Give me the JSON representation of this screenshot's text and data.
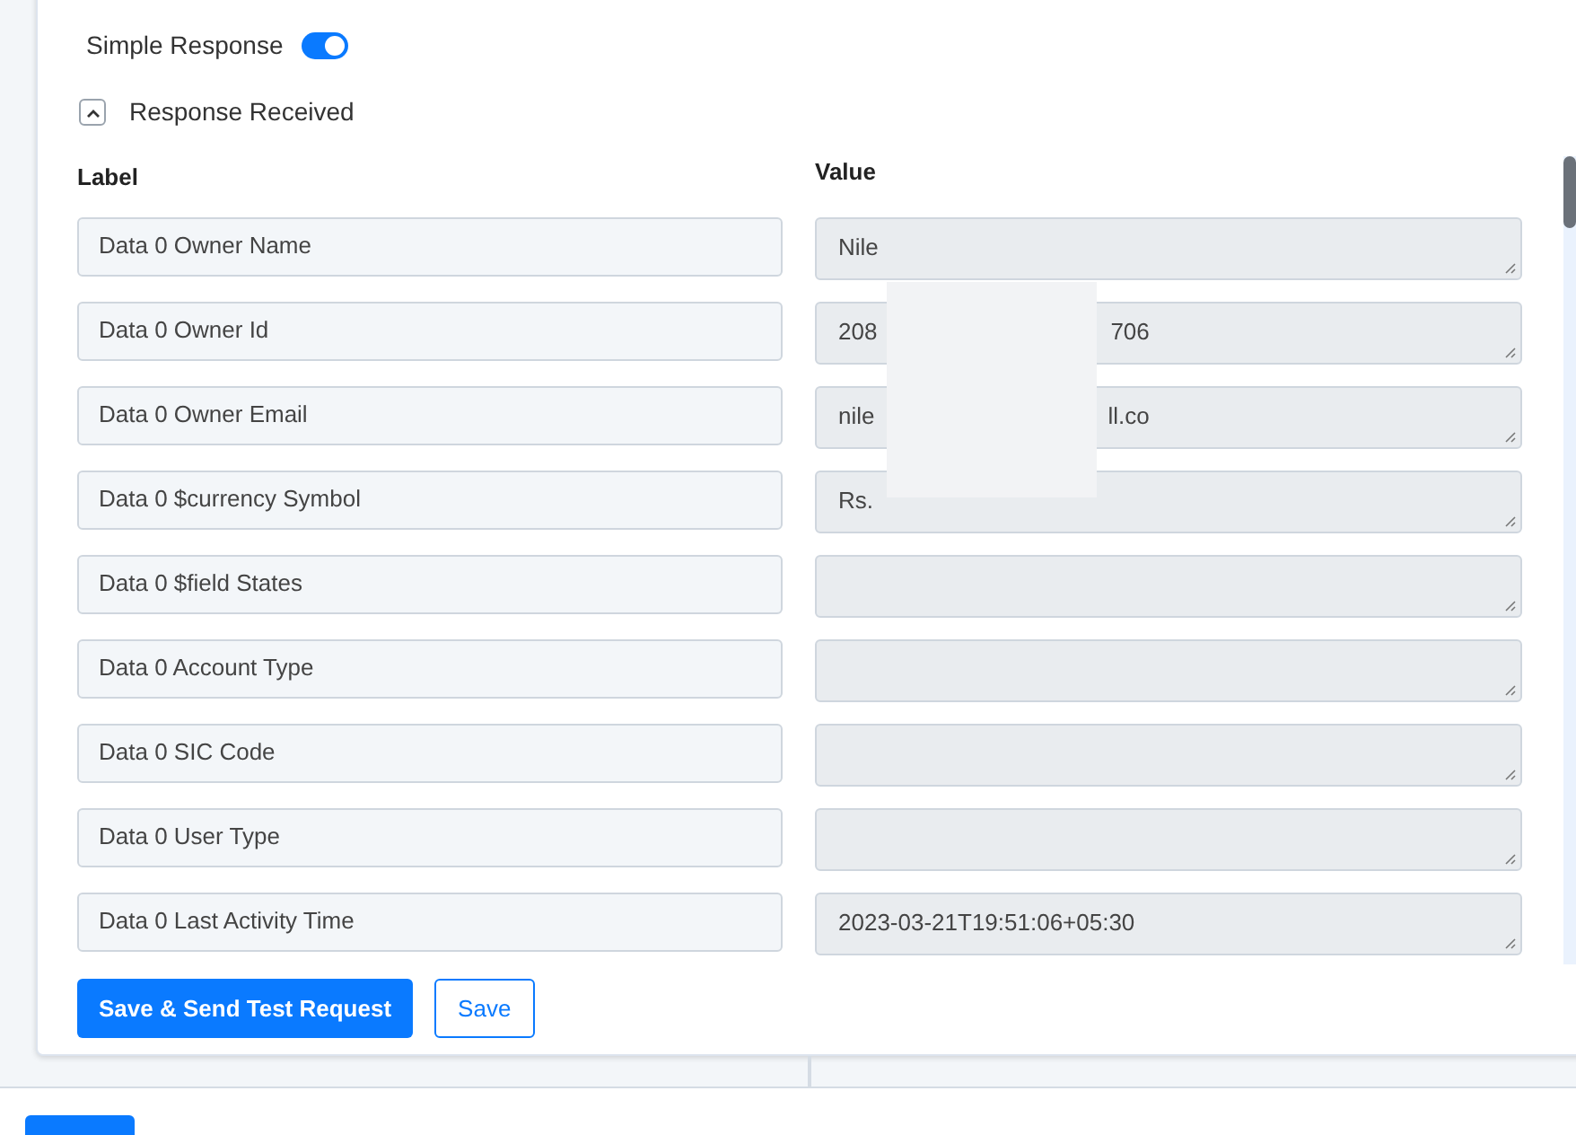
{
  "simple_response": {
    "label": "Simple Response",
    "on": true
  },
  "section": {
    "title": "Response Received",
    "expanded": true
  },
  "columns": {
    "label": "Label",
    "value": "Value"
  },
  "redaction_overlay": true,
  "rows": [
    {
      "label": "Data 0 Owner Name",
      "value_start": "Nile",
      "value_end": ""
    },
    {
      "label": "Data 0 Owner Id",
      "value_start": "208",
      "value_end": "706"
    },
    {
      "label": "Data 0 Owner Email",
      "value_start": "nile",
      "value_end": "ll.co"
    },
    {
      "label": "Data 0 $currency Symbol",
      "value_start": "Rs.",
      "value_end": ""
    },
    {
      "label": "Data 0 $field States",
      "value_start": "",
      "value_end": ""
    },
    {
      "label": "Data 0 Account Type",
      "value_start": "",
      "value_end": ""
    },
    {
      "label": "Data 0 SIC Code",
      "value_start": "",
      "value_end": ""
    },
    {
      "label": "Data 0 User Type",
      "value_start": "",
      "value_end": ""
    },
    {
      "label": "Data 0 Last Activity Time",
      "value_start": "2023-03-21T19:51:06+05:30",
      "value_end": ""
    }
  ],
  "buttons": {
    "primary": "Save & Send Test Request",
    "secondary": "Save"
  }
}
